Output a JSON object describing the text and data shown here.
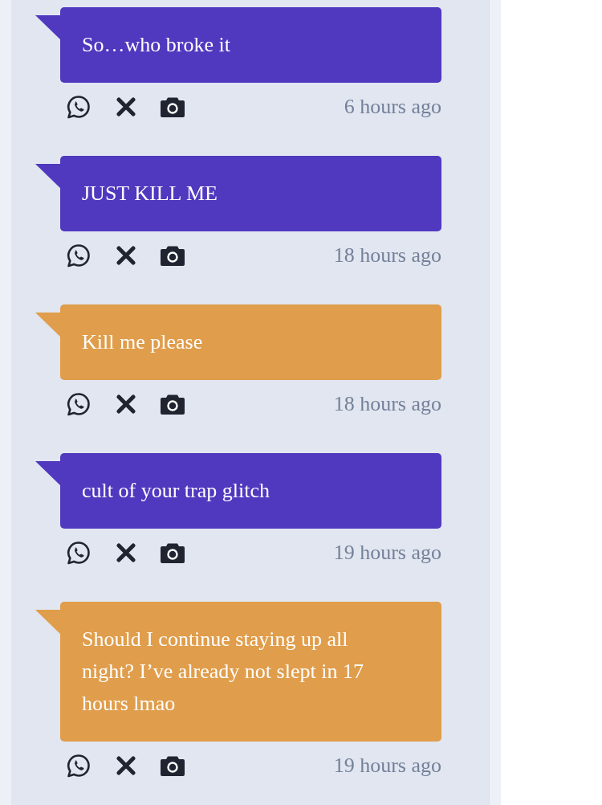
{
  "messages": [
    {
      "text": "So…who broke it",
      "time": "6 hours ago",
      "color": "#5038bf"
    },
    {
      "text": "JUST KILL ME",
      "time": "18 hours ago",
      "color": "#5038bf"
    },
    {
      "text": "Kill me please",
      "time": "18 hours ago",
      "color": "#e09d4b"
    },
    {
      "text": "cult of your trap glitch",
      "time": "19 hours ago",
      "color": "#5038bf"
    },
    {
      "text": "Should I continue staying up all night? I’ve already not slept in 17 hours lmao",
      "time": "19 hours ago",
      "color": "#e09d4b"
    }
  ]
}
